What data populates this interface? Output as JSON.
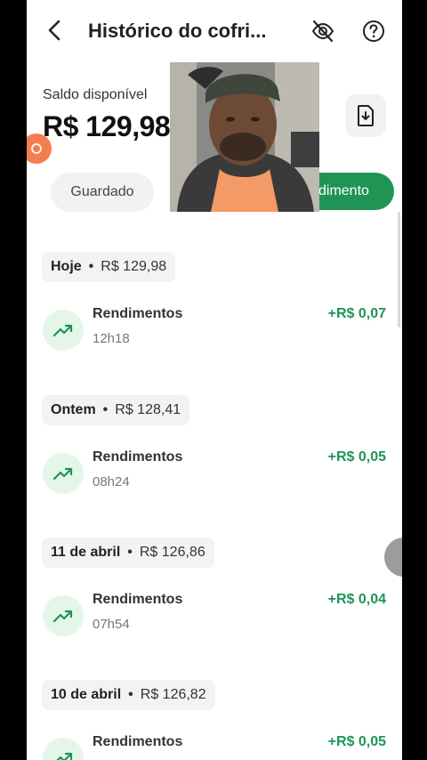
{
  "header": {
    "title": "Histórico do cofri...",
    "icons": {
      "back": "chevron-left-icon",
      "hide": "eye-off-icon",
      "help": "help-circle-icon"
    }
  },
  "balance": {
    "label": "Saldo disponível",
    "value": "R$ 129,98",
    "export_icon": "file-download-icon"
  },
  "tabs": [
    {
      "label": "Guardado"
    },
    {
      "label": "dimento",
      "selected": true
    }
  ],
  "history": [
    {
      "date": "Hoje",
      "total": "R$ 129,98",
      "entries": [
        {
          "title": "Rendimentos",
          "time": "12h18",
          "amount": "+R$ 0,07"
        }
      ]
    },
    {
      "date": "Ontem",
      "total": "R$ 128,41",
      "entries": [
        {
          "title": "Rendimentos",
          "time": "08h24",
          "amount": "+R$ 0,05"
        }
      ]
    },
    {
      "date": "11 de abril",
      "total": "R$ 126,86",
      "entries": [
        {
          "title": "Rendimentos",
          "time": "07h54",
          "amount": "+R$ 0,04"
        }
      ]
    },
    {
      "date": "10 de abril",
      "total": "R$ 126,82",
      "entries": [
        {
          "title": "Rendimentos",
          "time": "",
          "amount": "+R$ 0,05"
        }
      ]
    }
  ],
  "colors": {
    "accent": "#1f9455",
    "icon_bg": "#e4f6ea",
    "chip_bg": "#f3f3f3"
  }
}
